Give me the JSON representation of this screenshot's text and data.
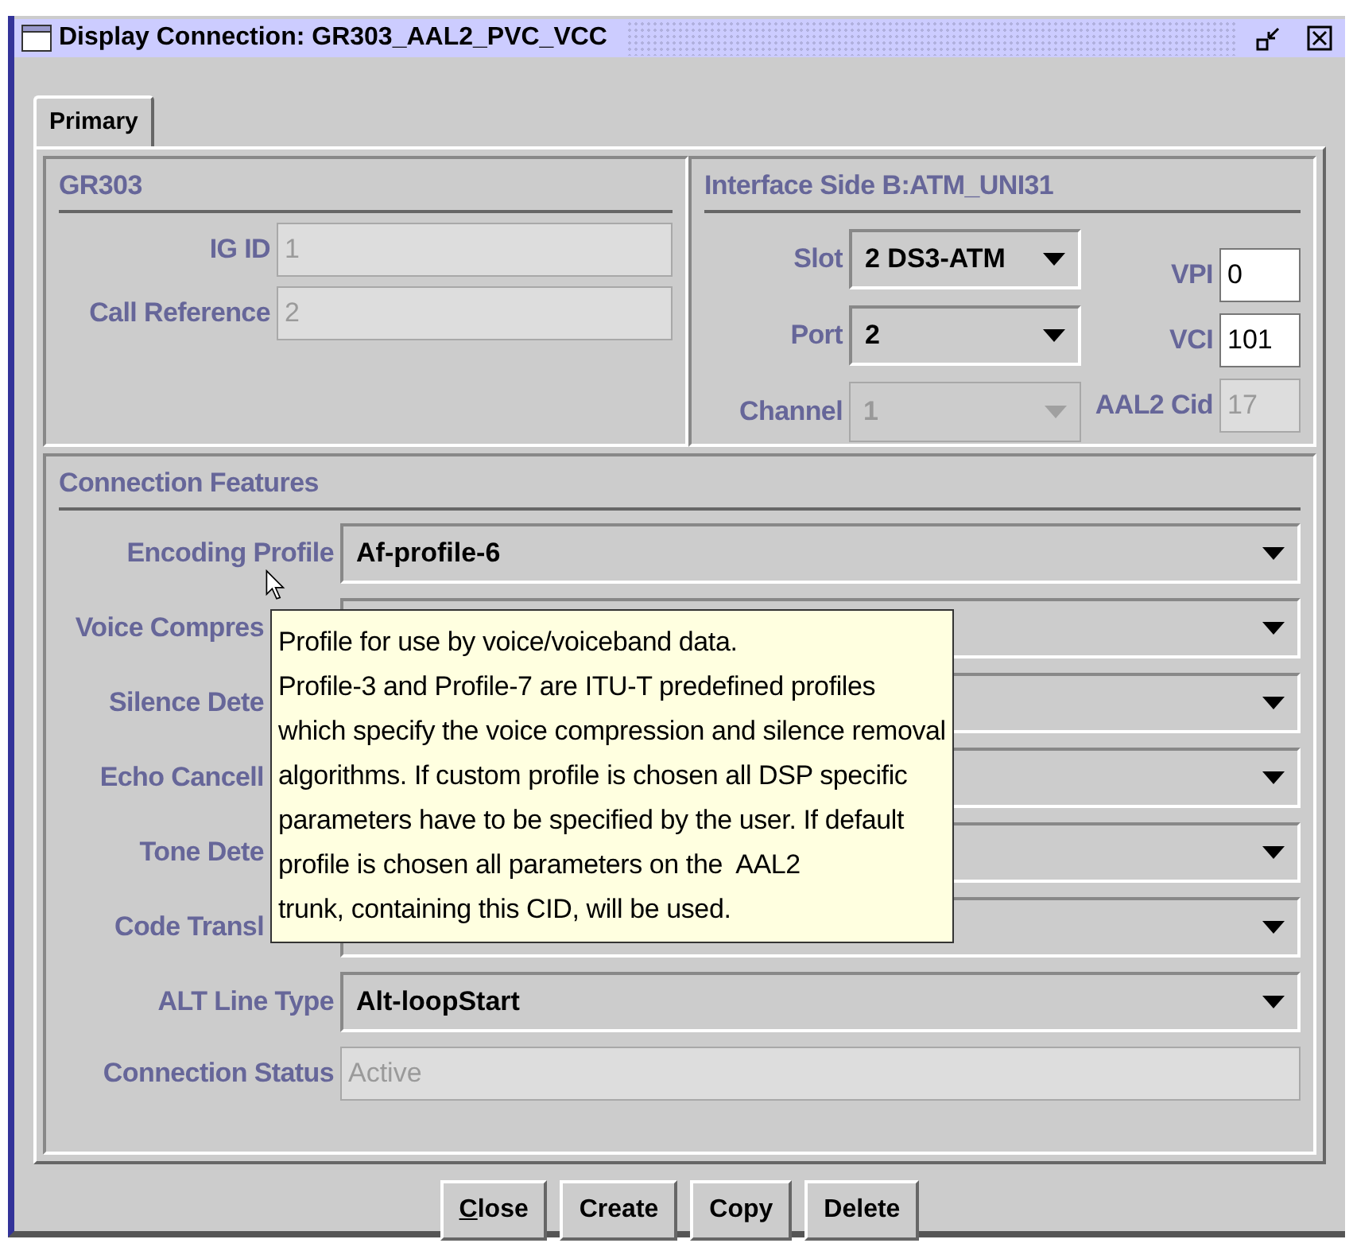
{
  "window": {
    "title": "Display Connection: GR303_AAL2_PVC_VCC"
  },
  "tabs": [
    {
      "label": "Primary",
      "selected": true
    }
  ],
  "gr303": {
    "title": "GR303",
    "fields": [
      {
        "label": "IG ID",
        "value": "1",
        "disabled": true
      },
      {
        "label": "Call Reference",
        "value": "2",
        "disabled": true
      }
    ]
  },
  "interface_side": {
    "title": "Interface Side B:ATM_UNI31",
    "combos": [
      {
        "label": "Slot",
        "value": "2 DS3-ATM",
        "disabled": false
      },
      {
        "label": "Port",
        "value": "2",
        "disabled": false
      },
      {
        "label": "Channel",
        "value": "1",
        "disabled": true
      }
    ],
    "fields": [
      {
        "label": "VPI",
        "value": "0",
        "disabled": false
      },
      {
        "label": "VCI",
        "value": "101",
        "disabled": false
      },
      {
        "label": "AAL2 Cid",
        "value": "17",
        "disabled": true
      }
    ]
  },
  "connection_features": {
    "title": "Connection Features",
    "rows": [
      {
        "kind": "combo",
        "label": "Encoding Profile",
        "value": "Af-profile-6"
      },
      {
        "kind": "combo",
        "label": "Voice Compres"
      },
      {
        "kind": "combo",
        "label": "Silence Dete"
      },
      {
        "kind": "combo",
        "label": "Echo Cancell"
      },
      {
        "kind": "combo",
        "label": "Tone Dete"
      },
      {
        "kind": "combo",
        "label": "Code Transl"
      },
      {
        "kind": "combo",
        "label": "ALT Line Type",
        "value": "Alt-loopStart"
      },
      {
        "kind": "field",
        "label": "Connection Status",
        "value": "Active"
      }
    ]
  },
  "tooltip": {
    "lines": [
      "Profile for use by voice/voiceband data.",
      "Profile-3 and Profile-7 are ITU-T predefined profiles",
      "which specify the voice compression and silence removal",
      "algorithms. If custom profile is chosen all DSP specific",
      "parameters have to be specified by the user. If default",
      "profile is chosen all parameters on the  AAL2",
      "trunk, containing this CID, will be used."
    ]
  },
  "buttons": [
    {
      "label": "Close",
      "mnemonic": true
    },
    {
      "label": "Create",
      "mnemonic": false
    },
    {
      "label": "Copy",
      "mnemonic": false
    },
    {
      "label": "Delete",
      "mnemonic": false
    }
  ]
}
